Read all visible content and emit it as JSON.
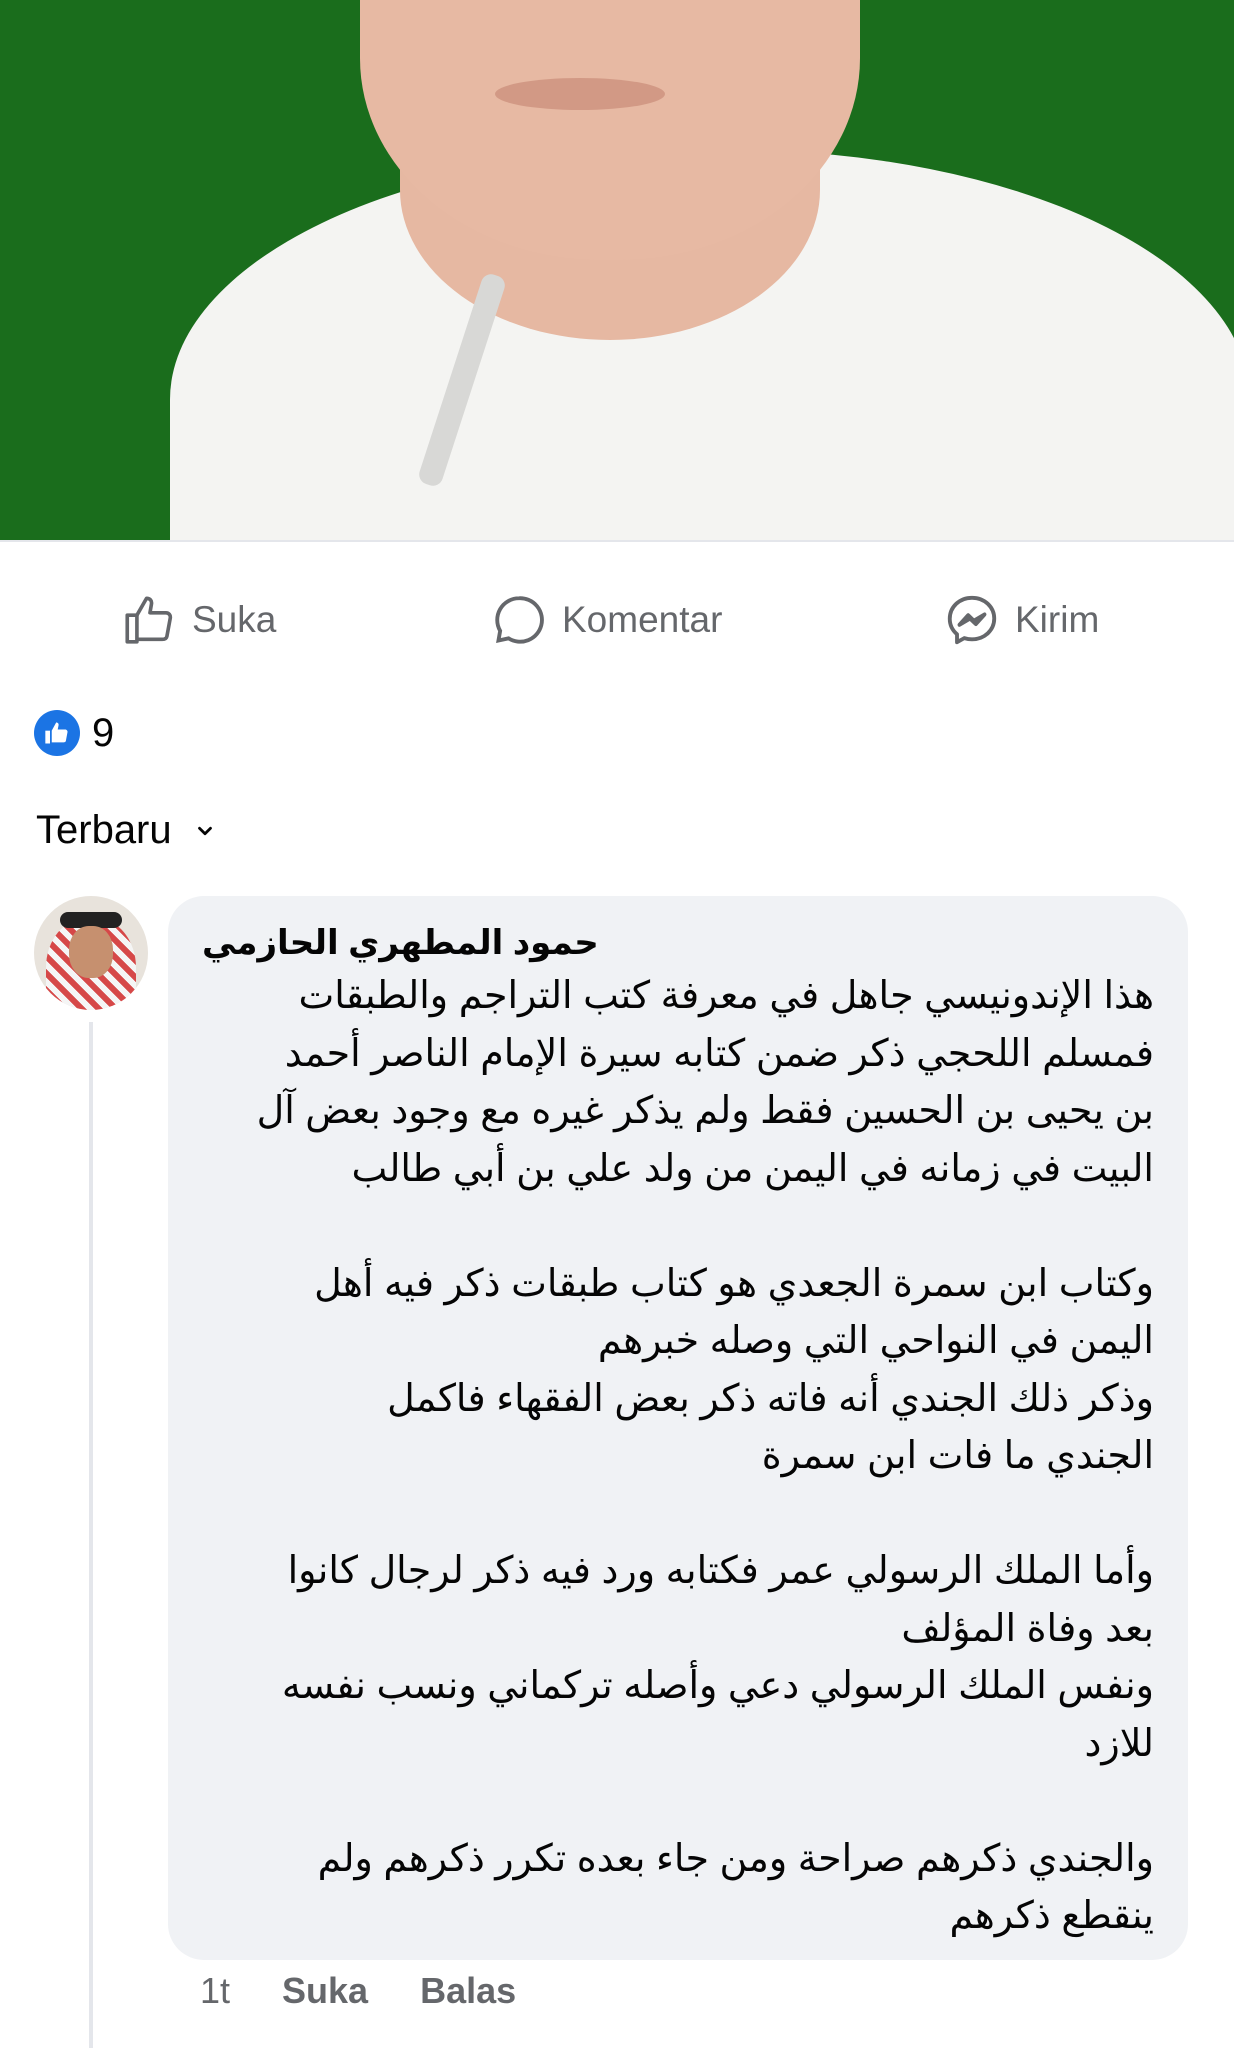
{
  "post": {
    "image": {
      "description_icon": "post-photo",
      "background_color": "#1a6d1c"
    }
  },
  "actions": {
    "like_label": "Suka",
    "comment_label": "Komentar",
    "send_label": "Kirim",
    "icons": {
      "like": "thumbs-up-icon",
      "comment": "speech-bubble-icon",
      "send": "messenger-icon"
    }
  },
  "reactions": {
    "count": "9",
    "icon": "like-reaction-icon",
    "color": "#1b74e4"
  },
  "sort": {
    "label": "Terbaru",
    "icon": "chevron-down-icon"
  },
  "comment": {
    "author": "حمود المطهري الحازمي",
    "lines": [
      "هذا الإندونيسي جاهل في معرفة كتب التراجم والطبقات",
      "فمسلم اللحجي ذكر ضمن كتابه سيرة الإمام الناصر أحمد",
      "بن يحيى بن الحسين فقط ولم يذكر غيره مع وجود بعض آل",
      "البيت في زمانه في اليمن من ولد علي بن أبي طالب",
      "",
      "وكتاب ابن سمرة الجعدي هو كتاب طبقات ذكر فيه أهل",
      "اليمن في النواحي التي وصله خبرهم",
      "وذكر ذلك الجندي أنه فاته ذكر بعض الفقهاء  فاكمل",
      "الجندي ما فات ابن سمرة",
      "",
      "وأما الملك الرسولي عمر فكتابه ورد فيه ذكر لرجال كانوا",
      "بعد وفاة المؤلف",
      "ونفس الملك الرسولي  دعي وأصله تركماني ونسب نفسه",
      "للازد",
      "",
      "والجندي ذكرهم صراحة ومن جاء بعده تكرر ذكرهم ولم",
      "ينقطع ذكرهم"
    ],
    "time": "1t",
    "like_label": "Suka",
    "reply_label": "Balas"
  },
  "colors": {
    "bubble": "#f0f2f5",
    "secondary_text": "#65676b",
    "divider": "#e4e6eb"
  }
}
